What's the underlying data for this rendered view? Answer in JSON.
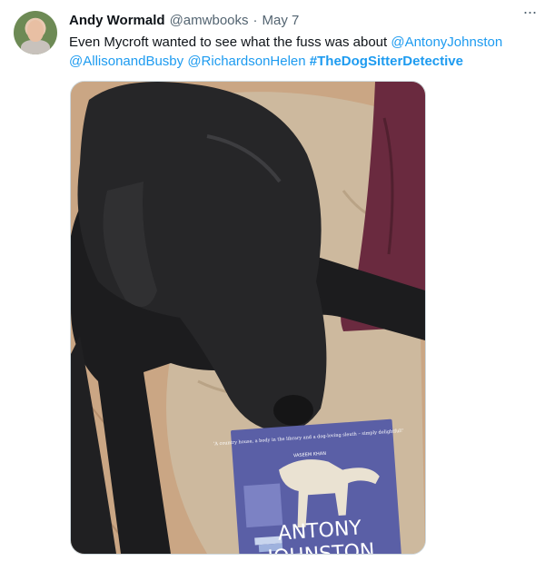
{
  "tweet": {
    "author_name": "Andy Wormald",
    "author_handle": "@amwbooks",
    "separator": "·",
    "date": "May 7",
    "more_icon": "ellipsis-icon",
    "text_intro": "Even Mycroft wanted to see what the fuss was about ",
    "mention_1": "@AntonyJohnston",
    "mention_2": "@AllisonandBusby",
    "mention_3": "@RichardsonHelen",
    "hashtag": "#TheDogSitterDetective",
    "link_color": "#1d9bf0"
  },
  "photo": {
    "book_quote": "'A country house, a body in the library and a dog-loving sleuth – simply delightful!'",
    "book_quote_author": "VASEEM KHAN",
    "book_author_line_1": "ANTONY",
    "book_author_line_2": "JOHNSTON"
  }
}
